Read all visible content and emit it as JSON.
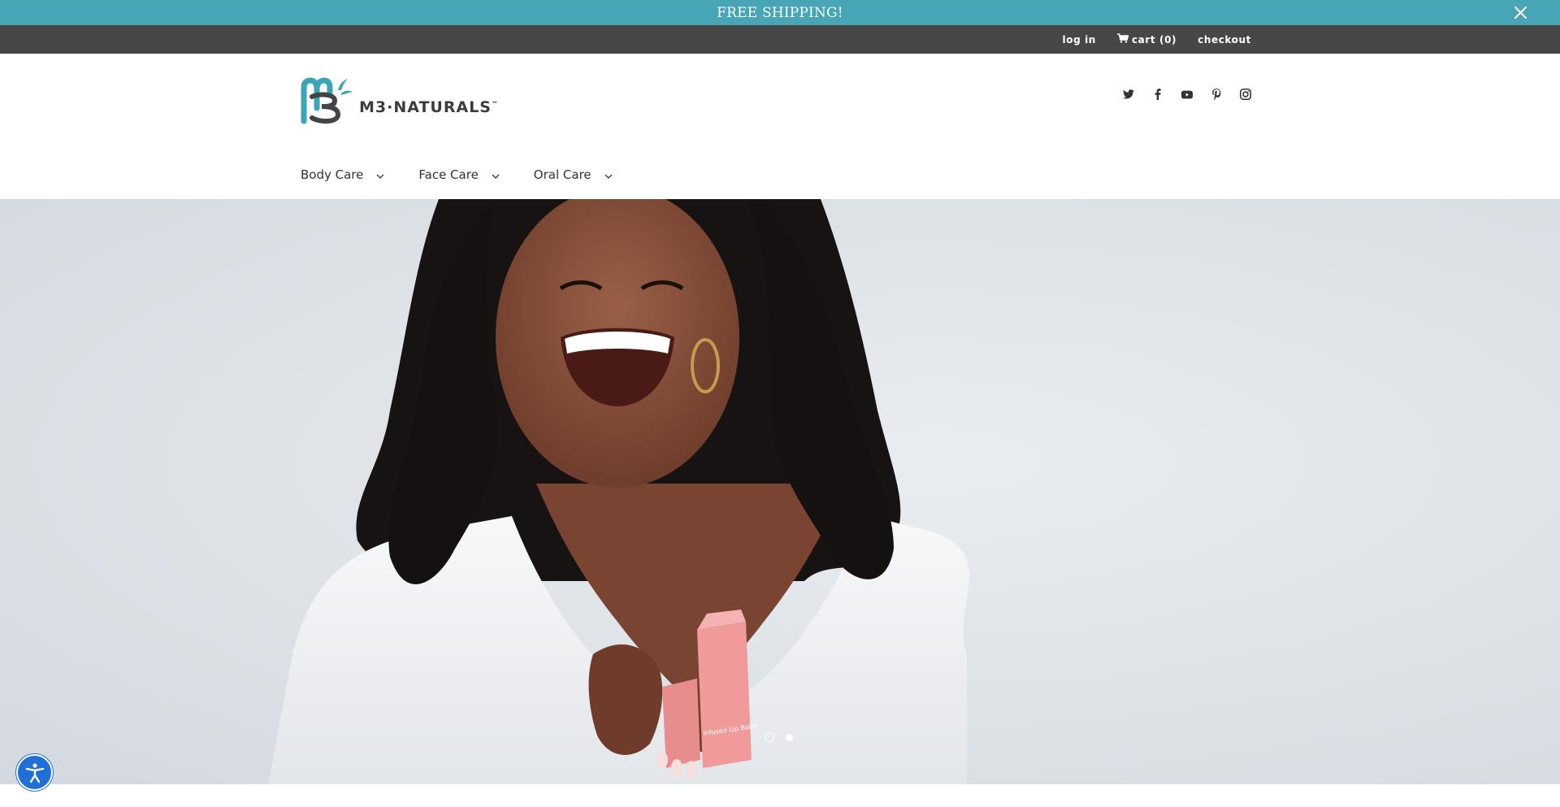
{
  "announcement": {
    "text": "FREE SHIPPING!",
    "close_icon": "close-icon"
  },
  "utility": {
    "login_label": "log in",
    "cart_label": "cart (0)",
    "cart_icon": "cart-icon",
    "checkout_label": "checkout"
  },
  "logo": {
    "text": "M3·NATURALS",
    "tm": "™"
  },
  "social": [
    "twitter-icon",
    "facebook-icon",
    "youtube-icon",
    "pinterest-icon",
    "instagram-icon"
  ],
  "nav": {
    "items": [
      {
        "label": "Body Care"
      },
      {
        "label": "Face Care"
      },
      {
        "label": "Oral Care"
      }
    ]
  },
  "hero": {
    "slides_total": 2,
    "active_slide": 1,
    "product_box_text": "Infused Lip Balm"
  },
  "colors": {
    "announce_bg": "#47a5b6",
    "utility_bg": "#474747",
    "brand_teal": "#3aa5b6",
    "a11y_blue": "#1f6fd6"
  },
  "accessibility_icon": "accessibility-icon"
}
